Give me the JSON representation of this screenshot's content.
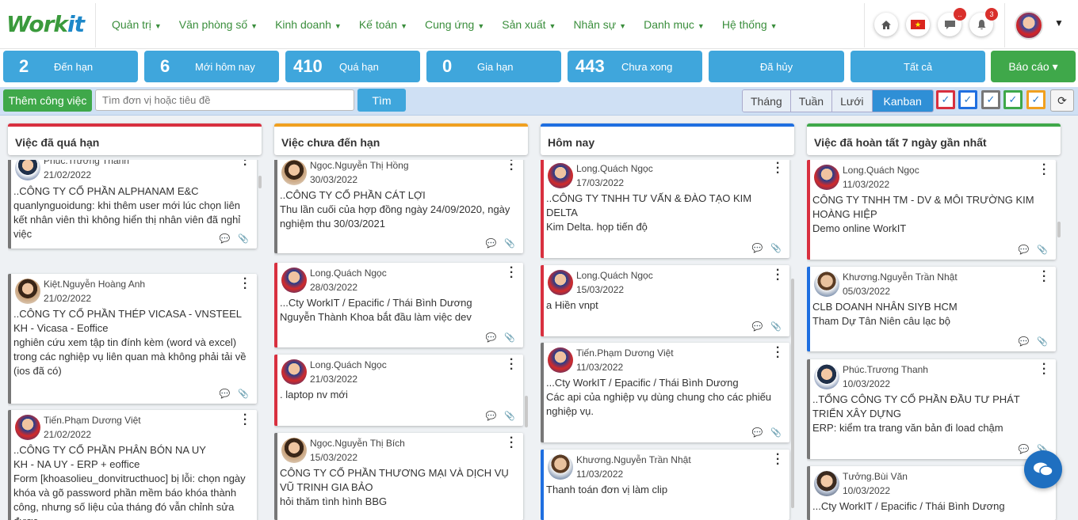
{
  "logo": {
    "left": "Work",
    "right": "it"
  },
  "menu": [
    "Quản trị",
    "Văn phòng số",
    "Kinh doanh",
    "Kế toán",
    "Cung ứng",
    "Sản xuất",
    "Nhân sự",
    "Danh mục",
    "Hệ thống"
  ],
  "header": {
    "flag_text": "★",
    "chat_badge": "..",
    "notif_badge": "3"
  },
  "stats": [
    {
      "num": "2",
      "label": "Đến hạn"
    },
    {
      "num": "6",
      "label": "Mới hôm nay"
    },
    {
      "num": "410",
      "label": "Quá hạn"
    },
    {
      "num": "0",
      "label": "Gia hạn"
    },
    {
      "num": "443",
      "label": "Chưa xong"
    },
    {
      "num": "",
      "label": "Đã hủy"
    },
    {
      "num": "",
      "label": "Tất cả"
    },
    {
      "num": "",
      "label": "Báo cáo ▾"
    }
  ],
  "toolbar": {
    "add_label": "Thêm công việc",
    "search_placeholder": "Tìm đơn vị hoặc tiêu đề",
    "find_label": "Tìm",
    "views": [
      "Tháng",
      "Tuần",
      "Lưới",
      "Kanban"
    ],
    "active_view": "Kanban",
    "filter_colors": [
      "#d8303f",
      "#1f6fe0",
      "#777777",
      "#3fa84a",
      "#f0a020"
    ]
  },
  "columns": [
    {
      "title": "Việc đã quá hạn",
      "color": "#d8303f",
      "cards": [
        {
          "user": "Phúc.Trương Thanh",
          "date": "21/02/2022",
          "lines": [
            "..CÔNG TY CỔ PHẦN ALPHANAM E&C",
            "quanlynguoidung: khi thêm user mới lúc chọn liên kết nhân viên thì không hiển thị nhân viên đã nghỉ việc"
          ]
        },
        {
          "user": "Kiệt.Nguyễn Hoàng Anh",
          "date": "21/02/2022",
          "lines": [
            "..CÔNG TY CỔ PHẦN THÉP VICASA - VNSTEEL",
            "KH - Vicasa - Eoffice",
            "nghiên cứu xem tập tin đính kèm (word và excel) trong các nghiệp vụ liên quan mà không phải tải về (ios đã có)"
          ]
        },
        {
          "user": "Tiến.Phạm Dương Việt",
          "date": "21/02/2022",
          "lines": [
            "..CÔNG TY CỔ PHẦN PHÂN BÓN NA UY",
            "KH - NA UY - ERP + eoffice",
            "Form [khoasolieu_donvitructhuoc] bị lỗi: chọn ngày khóa và gõ password phần mềm báo khóa thành công, nhưng số liệu của tháng đó vẫn chỉnh sửa được"
          ]
        }
      ]
    },
    {
      "title": "Việc chưa đến hạn",
      "color": "#f0a020",
      "cards": [
        {
          "user": "Ngọc.Nguyễn Thị Hồng",
          "date": "30/03/2022",
          "lines": [
            "..CÔNG TY CỔ PHẦN CÁT LỢI",
            "Thu lần cuối của hợp đồng ngày 24/09/2020, ngày nghiệm thu 30/03/2021"
          ]
        },
        {
          "user": "Long.Quách Ngọc",
          "date": "28/03/2022",
          "lines": [
            "...Cty WorkIT / Epacific / Thái Bình Dương",
            "Nguyễn Thành Khoa bắt đầu làm việc dev"
          ]
        },
        {
          "user": "Long.Quách Ngọc",
          "date": "21/03/2022",
          "lines": [
            ". laptop nv mới"
          ]
        },
        {
          "user": "Ngọc.Nguyễn Thị Bích",
          "date": "15/03/2022",
          "lines": [
            "CÔNG TY CỔ PHẦN THƯƠNG MẠI VÀ DỊCH VỤ VŨ TRINH GIA BẢO",
            "hỏi thăm tình hình BBG"
          ]
        }
      ]
    },
    {
      "title": "Hôm nay",
      "color": "#1f6fe0",
      "cards": [
        {
          "user": "Long.Quách Ngọc",
          "date": "17/03/2022",
          "lines": [
            "..CÔNG TY TNHH TƯ VẤN & ĐÀO TẠO KIM DELTA",
            "Kim Delta. họp tiến độ"
          ]
        },
        {
          "user": "Long.Quách Ngọc",
          "date": "15/03/2022",
          "lines": [
            "a Hiền vnpt"
          ]
        },
        {
          "user": "Tiến.Phạm Dương Việt",
          "date": "11/03/2022",
          "lines": [
            "...Cty WorkIT / Epacific / Thái Bình Dương",
            "Các api của nghiệp vụ dùng chung cho các phiếu nghiệp vụ."
          ]
        },
        {
          "user": "Khương.Nguyễn Trần Nhật",
          "date": "11/03/2022",
          "lines": [
            "Thanh toán đơn vị làm clip"
          ]
        }
      ]
    },
    {
      "title": "Việc đã hoàn tất 7 ngày gần nhất",
      "color": "#3fa84a",
      "cards": [
        {
          "user": "Long.Quách Ngọc",
          "date": "11/03/2022",
          "lines": [
            "CÔNG TY TNHH TM - DV & MÔI TRƯỜNG KIM HOÀNG HIỆP",
            "Demo online WorkIT"
          ]
        },
        {
          "user": "Khương.Nguyễn Trần Nhật",
          "date": "05/03/2022",
          "lines": [
            "CLB DOANH NHÂN SIYB HCM",
            "Tham Dự Tân Niên câu lạc bộ"
          ]
        },
        {
          "user": "Phúc.Trương Thanh",
          "date": "10/03/2022",
          "lines": [
            "..TỔNG CÔNG TY CỔ PHẦN ĐẦU TƯ PHÁT TRIỂN XÂY DỰNG",
            "ERP: kiểm tra trang văn bản đi load chậm"
          ]
        },
        {
          "user": "Tưởng.Bùi Văn",
          "date": "10/03/2022",
          "lines": [
            "...Cty WorkIT / Epacific / Thái Bình Dương"
          ]
        }
      ]
    }
  ]
}
